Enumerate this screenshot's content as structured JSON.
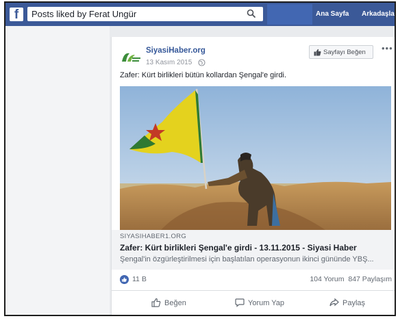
{
  "topbar": {
    "search_value": "Posts liked by Ferat Ungür",
    "nav_home": "Ana Sayfa",
    "nav_friends": "Arkadaşla"
  },
  "post": {
    "page_name": "SiyasiHaber.org",
    "date": "13 Kasım 2015",
    "like_page_label": "Sayfayı Beğen",
    "text": "Zafer: Kürt birlikleri bütün kollardan Şengal'e girdi.",
    "link": {
      "domain": "SIYASIHABER1.ORG",
      "title": "Zafer: Kürt birlikleri Şengal'e girdi - 13.11.2015 - Siyasi Haber",
      "description": "Şengal'in özgürleştirilmesi için başlatılan operasyonun ikinci gününde YBŞ..."
    },
    "reactions_count": "11 B",
    "comments_count": "104 Yorum",
    "shares_count": "847 Paylaşım",
    "actions": {
      "like": "Beğen",
      "comment": "Yorum Yap",
      "share": "Paylaş"
    }
  },
  "colors": {
    "facebook_blue": "#3b5998",
    "link_blue": "#365899",
    "flag_yellow": "#e4d21e",
    "flag_green": "#2f7a32",
    "flag_star_red": "#c23a26"
  },
  "icons": [
    "facebook-logo-icon",
    "search-icon",
    "globe-icon",
    "thumbs-up-icon",
    "more-options-icon",
    "comment-icon",
    "share-icon"
  ]
}
